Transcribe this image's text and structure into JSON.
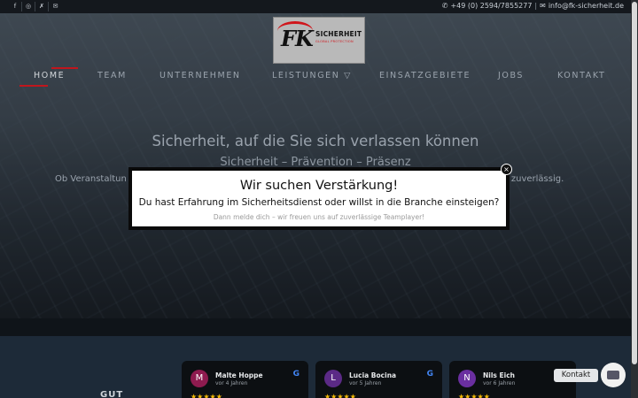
{
  "topbar": {
    "social": [
      {
        "icon": "facebook-icon",
        "glyph": "f"
      },
      {
        "icon": "instagram-icon",
        "glyph": "◎"
      },
      {
        "icon": "xing-icon",
        "glyph": "✗"
      },
      {
        "icon": "mail-icon",
        "glyph": "✉"
      }
    ],
    "phone_icon": "phone-icon",
    "phone": "+49 (0) 2594/7855277",
    "email_icon": "mail-icon",
    "email": "info@fk-sicherheit.de"
  },
  "logo": {
    "mark": "FK",
    "name": "SICHERHEIT",
    "tagline": "GLOBAL PROTECTION"
  },
  "nav": {
    "items": [
      {
        "label": "HOME",
        "active": true
      },
      {
        "label": "TEAM"
      },
      {
        "label": "UNTERNEHMEN"
      },
      {
        "label": "LEISTUNGEN ▽"
      },
      {
        "label": "EINSATZGEBIETE"
      },
      {
        "label": "JOBS"
      },
      {
        "label": "KONTAKT"
      }
    ]
  },
  "hero": {
    "title": "Sicherheit, auf die Sie sich verlassen können",
    "subtitle": "Sicherheit – Prävention – Präsenz",
    "text_left": "Ob Veranstaltun",
    "text_right": "nd zuverlässig."
  },
  "reviews": {
    "heading_partial": "GUT",
    "cards": [
      {
        "initial": "M",
        "name": "Malte Hoppe",
        "time": "vor 4 Jahren",
        "stars": "★★★★★",
        "color": "#8e1b4f"
      },
      {
        "initial": "L",
        "name": "Lucia Bocina",
        "time": "vor 5 Jahren",
        "stars": "★★★★★",
        "color": "#5b2a86"
      },
      {
        "initial": "N",
        "name": "Nils Eich",
        "time": "vor 6 Jahren",
        "stars": "★★★★★",
        "color": "#6a2fa0"
      }
    ],
    "google_glyph": "G"
  },
  "contact_widget": {
    "label": "Kontakt",
    "icon": "envelope-icon"
  },
  "modal": {
    "title": "Wir suchen Verstärkung!",
    "line": "Du hast Erfahrung im Sicherheitsdienst oder willst in die Branche einsteigen?",
    "small": "Dann melde dich – wir freuen uns auf zuverlässige Teamplayer!",
    "close_glyph": "×"
  },
  "colors": {
    "accent": "#c0161d",
    "star": "#f6bb06"
  }
}
